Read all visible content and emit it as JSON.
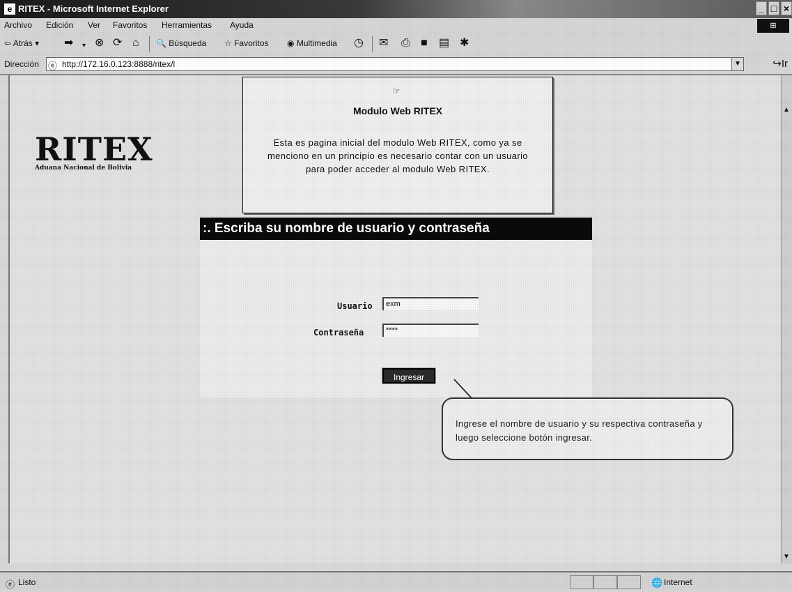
{
  "window": {
    "title": "RITEX - Microsoft Internet Explorer",
    "controls": [
      "_",
      "□",
      "×"
    ]
  },
  "menu": {
    "items": [
      "Archivo",
      "Edición",
      "Ver",
      "Favoritos",
      "Herramientas",
      "Ayuda"
    ]
  },
  "toolbar": {
    "back_label": "Atrás",
    "search_label": "Búsqueda",
    "favorites_label": "Favoritos",
    "media_label": "Multimedia"
  },
  "address": {
    "label": "Dirección",
    "url": "http://172.16.0.123:8888/ritex/l",
    "go_label": "Ir"
  },
  "page": {
    "logo_title": "RITEX",
    "logo_subtitle": "Aduana Nacional de Bolivia",
    "login_header": ":. Escriba su nombre de usuario y contraseña",
    "user_label": "Usuario",
    "user_value": "exm",
    "password_label": "Contraseña",
    "password_value": "****",
    "submit_label": "Ingresar"
  },
  "tooltip": {
    "title": "Modulo Web RITEX",
    "body": "Esta es pagina inicial del modulo Web RITEX, como ya se menciono en un principio es necesario contar con un usuario para poder acceder al modulo Web RITEX."
  },
  "callout": {
    "text": "Ingrese el nombre de usuario y su respectiva contraseña y luego seleccione botón ingresar."
  },
  "status": {
    "text": "Listo",
    "zone": "Internet"
  }
}
